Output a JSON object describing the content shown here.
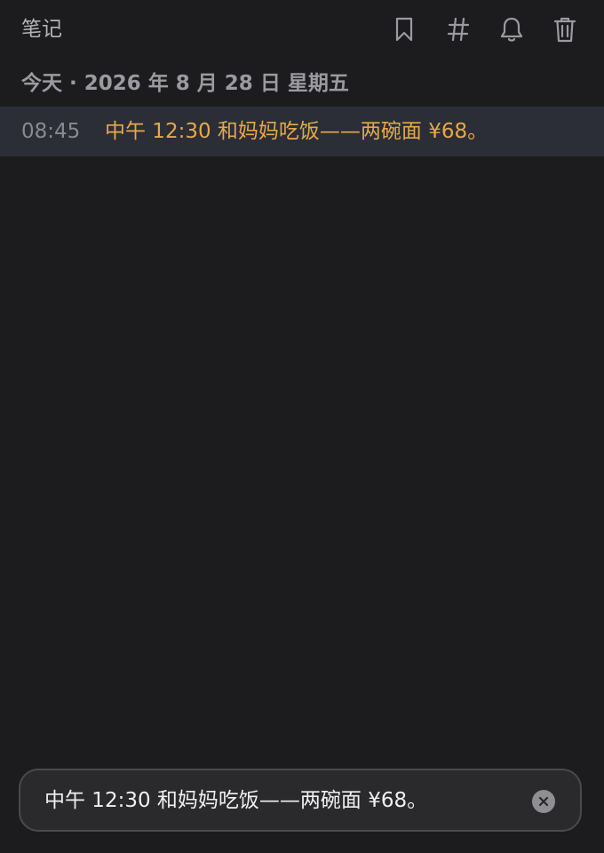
{
  "app": {
    "title": "笔记"
  },
  "toolbar": {
    "icons": [
      "bookmark-icon",
      "hashtag-icon",
      "bell-icon",
      "trash-icon"
    ]
  },
  "day_header": {
    "label": "今天 · 2026 年 8 月 28 日 星期五"
  },
  "notes": [
    {
      "time": "08:45",
      "text": "中午 12:30 和妈妈吃饭——两碗面 ¥68。"
    }
  ],
  "composer": {
    "value": "中午 12:30 和妈妈吃饭——两碗面 ¥68。",
    "clear_icon": "clear-icon"
  },
  "colors": {
    "background": "#1c1c1e",
    "selected_row": "#2b2e36",
    "highlight_text": "#e6a84a",
    "muted_text": "#8a8a90"
  }
}
